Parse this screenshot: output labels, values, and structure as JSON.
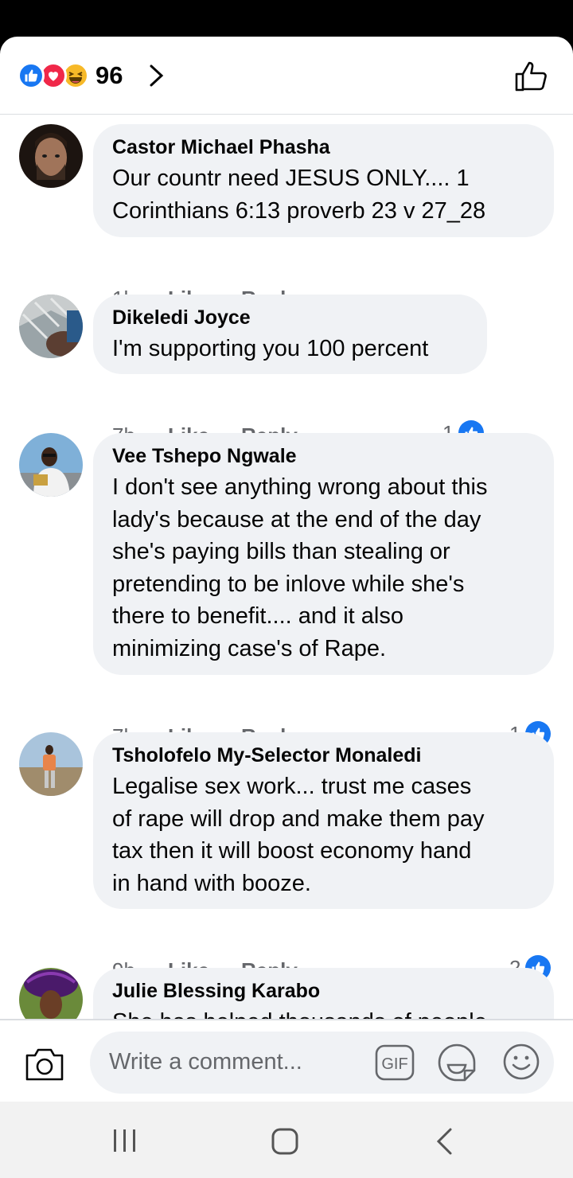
{
  "header": {
    "reaction_count": "96",
    "reactions": [
      "like-icon",
      "love-icon",
      "haha-icon"
    ]
  },
  "comments": [
    {
      "name": "Castor Michael Phasha",
      "lines": [
        "Our countr need JESUS ONLY.... 1",
        "Corinthians 6:13 proverb 23 v 27_28"
      ],
      "time": "1h",
      "like": "Like",
      "reply": "Reply",
      "like_count": ""
    },
    {
      "name": "Dikeledi Joyce",
      "lines": [
        "I'm supporting you 100 percent"
      ],
      "time": "7h",
      "like": "Like",
      "reply": "Reply",
      "like_count": "1"
    },
    {
      "name": "Vee Tshepo Ngwale",
      "lines": [
        "I don't see anything wrong about this",
        "lady's because at the end of the day",
        "she's paying bills than stealing or",
        "pretending to be inlove while she's",
        "there to benefit.... and it also",
        "minimizing case's of Rape."
      ],
      "time": "7h",
      "like": "Like",
      "reply": "Reply",
      "like_count": "1"
    },
    {
      "name": "Tsholofelo My-Selector Monaledi",
      "lines": [
        "Legalise sex work... trust me cases",
        "of rape will drop and make them pay",
        "tax then it will boost economy hand",
        "in hand with booze."
      ],
      "time": "9h",
      "like": "Like",
      "reply": "Reply",
      "like_count": "2"
    },
    {
      "name": "Julie Blessing Karabo",
      "lines": [
        "She has helped thousands of people"
      ],
      "time": "",
      "like": "",
      "reply": "",
      "like_count": ""
    }
  ],
  "composer": {
    "placeholder": "Write a comment...",
    "gif_label": "GIF"
  },
  "colors": {
    "accent": "#1877f2",
    "bubble": "#f0f2f5",
    "secondary_text": "#65676b"
  }
}
